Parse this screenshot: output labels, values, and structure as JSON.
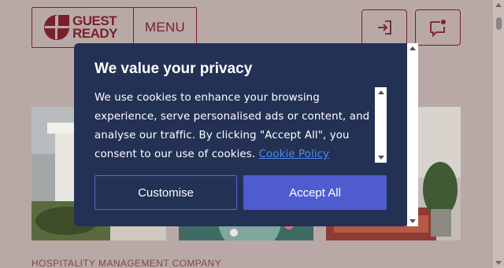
{
  "header": {
    "logo_line1": "GUEST",
    "logo_line2": "READY",
    "menu_label": "MENU",
    "login_icon": "login-icon",
    "chat_icon": "chat-notification-icon"
  },
  "hero": {
    "caption": "HOSPITALITY MANAGEMENT COMPANY"
  },
  "cookie_modal": {
    "title": "We value your privacy",
    "body": "We use cookies to enhance your browsing experience, serve personalised ads or content, and analyse our traffic. By clicking \"Accept All\", you consent to our use of cookies.",
    "link_label": "Cookie Policy",
    "customise_label": "Customise",
    "accept_label": "Accept All"
  },
  "colors": {
    "brand": "#7a1f2b",
    "modal_bg": "#233155",
    "accept_bg": "#4f5cd0",
    "link": "#4d8cf5",
    "overlay_bg": "#b9a9a6"
  }
}
